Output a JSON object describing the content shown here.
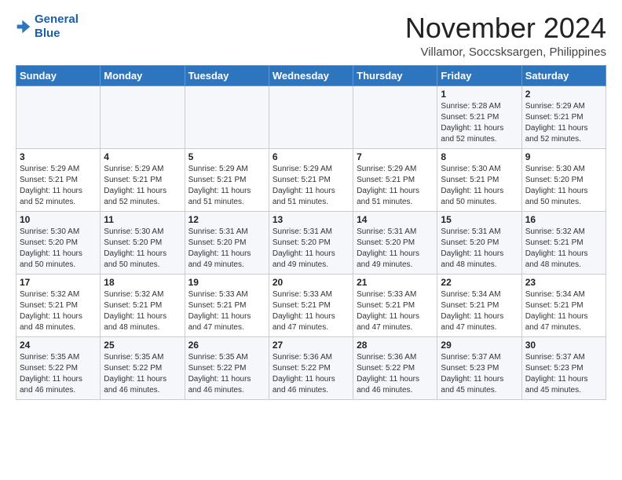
{
  "logo": {
    "line1": "General",
    "line2": "Blue"
  },
  "title": "November 2024",
  "subtitle": "Villamor, Soccsksargen, Philippines",
  "days_of_week": [
    "Sunday",
    "Monday",
    "Tuesday",
    "Wednesday",
    "Thursday",
    "Friday",
    "Saturday"
  ],
  "weeks": [
    [
      {
        "day": "",
        "sunrise": "",
        "sunset": "",
        "daylight": ""
      },
      {
        "day": "",
        "sunrise": "",
        "sunset": "",
        "daylight": ""
      },
      {
        "day": "",
        "sunrise": "",
        "sunset": "",
        "daylight": ""
      },
      {
        "day": "",
        "sunrise": "",
        "sunset": "",
        "daylight": ""
      },
      {
        "day": "",
        "sunrise": "",
        "sunset": "",
        "daylight": ""
      },
      {
        "day": "1",
        "sunrise": "5:28 AM",
        "sunset": "5:21 PM",
        "daylight": "11 hours and 52 minutes."
      },
      {
        "day": "2",
        "sunrise": "5:29 AM",
        "sunset": "5:21 PM",
        "daylight": "11 hours and 52 minutes."
      }
    ],
    [
      {
        "day": "3",
        "sunrise": "5:29 AM",
        "sunset": "5:21 PM",
        "daylight": "11 hours and 52 minutes."
      },
      {
        "day": "4",
        "sunrise": "5:29 AM",
        "sunset": "5:21 PM",
        "daylight": "11 hours and 52 minutes."
      },
      {
        "day": "5",
        "sunrise": "5:29 AM",
        "sunset": "5:21 PM",
        "daylight": "11 hours and 51 minutes."
      },
      {
        "day": "6",
        "sunrise": "5:29 AM",
        "sunset": "5:21 PM",
        "daylight": "11 hours and 51 minutes."
      },
      {
        "day": "7",
        "sunrise": "5:29 AM",
        "sunset": "5:21 PM",
        "daylight": "11 hours and 51 minutes."
      },
      {
        "day": "8",
        "sunrise": "5:30 AM",
        "sunset": "5:21 PM",
        "daylight": "11 hours and 50 minutes."
      },
      {
        "day": "9",
        "sunrise": "5:30 AM",
        "sunset": "5:20 PM",
        "daylight": "11 hours and 50 minutes."
      }
    ],
    [
      {
        "day": "10",
        "sunrise": "5:30 AM",
        "sunset": "5:20 PM",
        "daylight": "11 hours and 50 minutes."
      },
      {
        "day": "11",
        "sunrise": "5:30 AM",
        "sunset": "5:20 PM",
        "daylight": "11 hours and 50 minutes."
      },
      {
        "day": "12",
        "sunrise": "5:31 AM",
        "sunset": "5:20 PM",
        "daylight": "11 hours and 49 minutes."
      },
      {
        "day": "13",
        "sunrise": "5:31 AM",
        "sunset": "5:20 PM",
        "daylight": "11 hours and 49 minutes."
      },
      {
        "day": "14",
        "sunrise": "5:31 AM",
        "sunset": "5:20 PM",
        "daylight": "11 hours and 49 minutes."
      },
      {
        "day": "15",
        "sunrise": "5:31 AM",
        "sunset": "5:20 PM",
        "daylight": "11 hours and 48 minutes."
      },
      {
        "day": "16",
        "sunrise": "5:32 AM",
        "sunset": "5:21 PM",
        "daylight": "11 hours and 48 minutes."
      }
    ],
    [
      {
        "day": "17",
        "sunrise": "5:32 AM",
        "sunset": "5:21 PM",
        "daylight": "11 hours and 48 minutes."
      },
      {
        "day": "18",
        "sunrise": "5:32 AM",
        "sunset": "5:21 PM",
        "daylight": "11 hours and 48 minutes."
      },
      {
        "day": "19",
        "sunrise": "5:33 AM",
        "sunset": "5:21 PM",
        "daylight": "11 hours and 47 minutes."
      },
      {
        "day": "20",
        "sunrise": "5:33 AM",
        "sunset": "5:21 PM",
        "daylight": "11 hours and 47 minutes."
      },
      {
        "day": "21",
        "sunrise": "5:33 AM",
        "sunset": "5:21 PM",
        "daylight": "11 hours and 47 minutes."
      },
      {
        "day": "22",
        "sunrise": "5:34 AM",
        "sunset": "5:21 PM",
        "daylight": "11 hours and 47 minutes."
      },
      {
        "day": "23",
        "sunrise": "5:34 AM",
        "sunset": "5:21 PM",
        "daylight": "11 hours and 47 minutes."
      }
    ],
    [
      {
        "day": "24",
        "sunrise": "5:35 AM",
        "sunset": "5:22 PM",
        "daylight": "11 hours and 46 minutes."
      },
      {
        "day": "25",
        "sunrise": "5:35 AM",
        "sunset": "5:22 PM",
        "daylight": "11 hours and 46 minutes."
      },
      {
        "day": "26",
        "sunrise": "5:35 AM",
        "sunset": "5:22 PM",
        "daylight": "11 hours and 46 minutes."
      },
      {
        "day": "27",
        "sunrise": "5:36 AM",
        "sunset": "5:22 PM",
        "daylight": "11 hours and 46 minutes."
      },
      {
        "day": "28",
        "sunrise": "5:36 AM",
        "sunset": "5:22 PM",
        "daylight": "11 hours and 46 minutes."
      },
      {
        "day": "29",
        "sunrise": "5:37 AM",
        "sunset": "5:23 PM",
        "daylight": "11 hours and 45 minutes."
      },
      {
        "day": "30",
        "sunrise": "5:37 AM",
        "sunset": "5:23 PM",
        "daylight": "11 hours and 45 minutes."
      }
    ]
  ]
}
